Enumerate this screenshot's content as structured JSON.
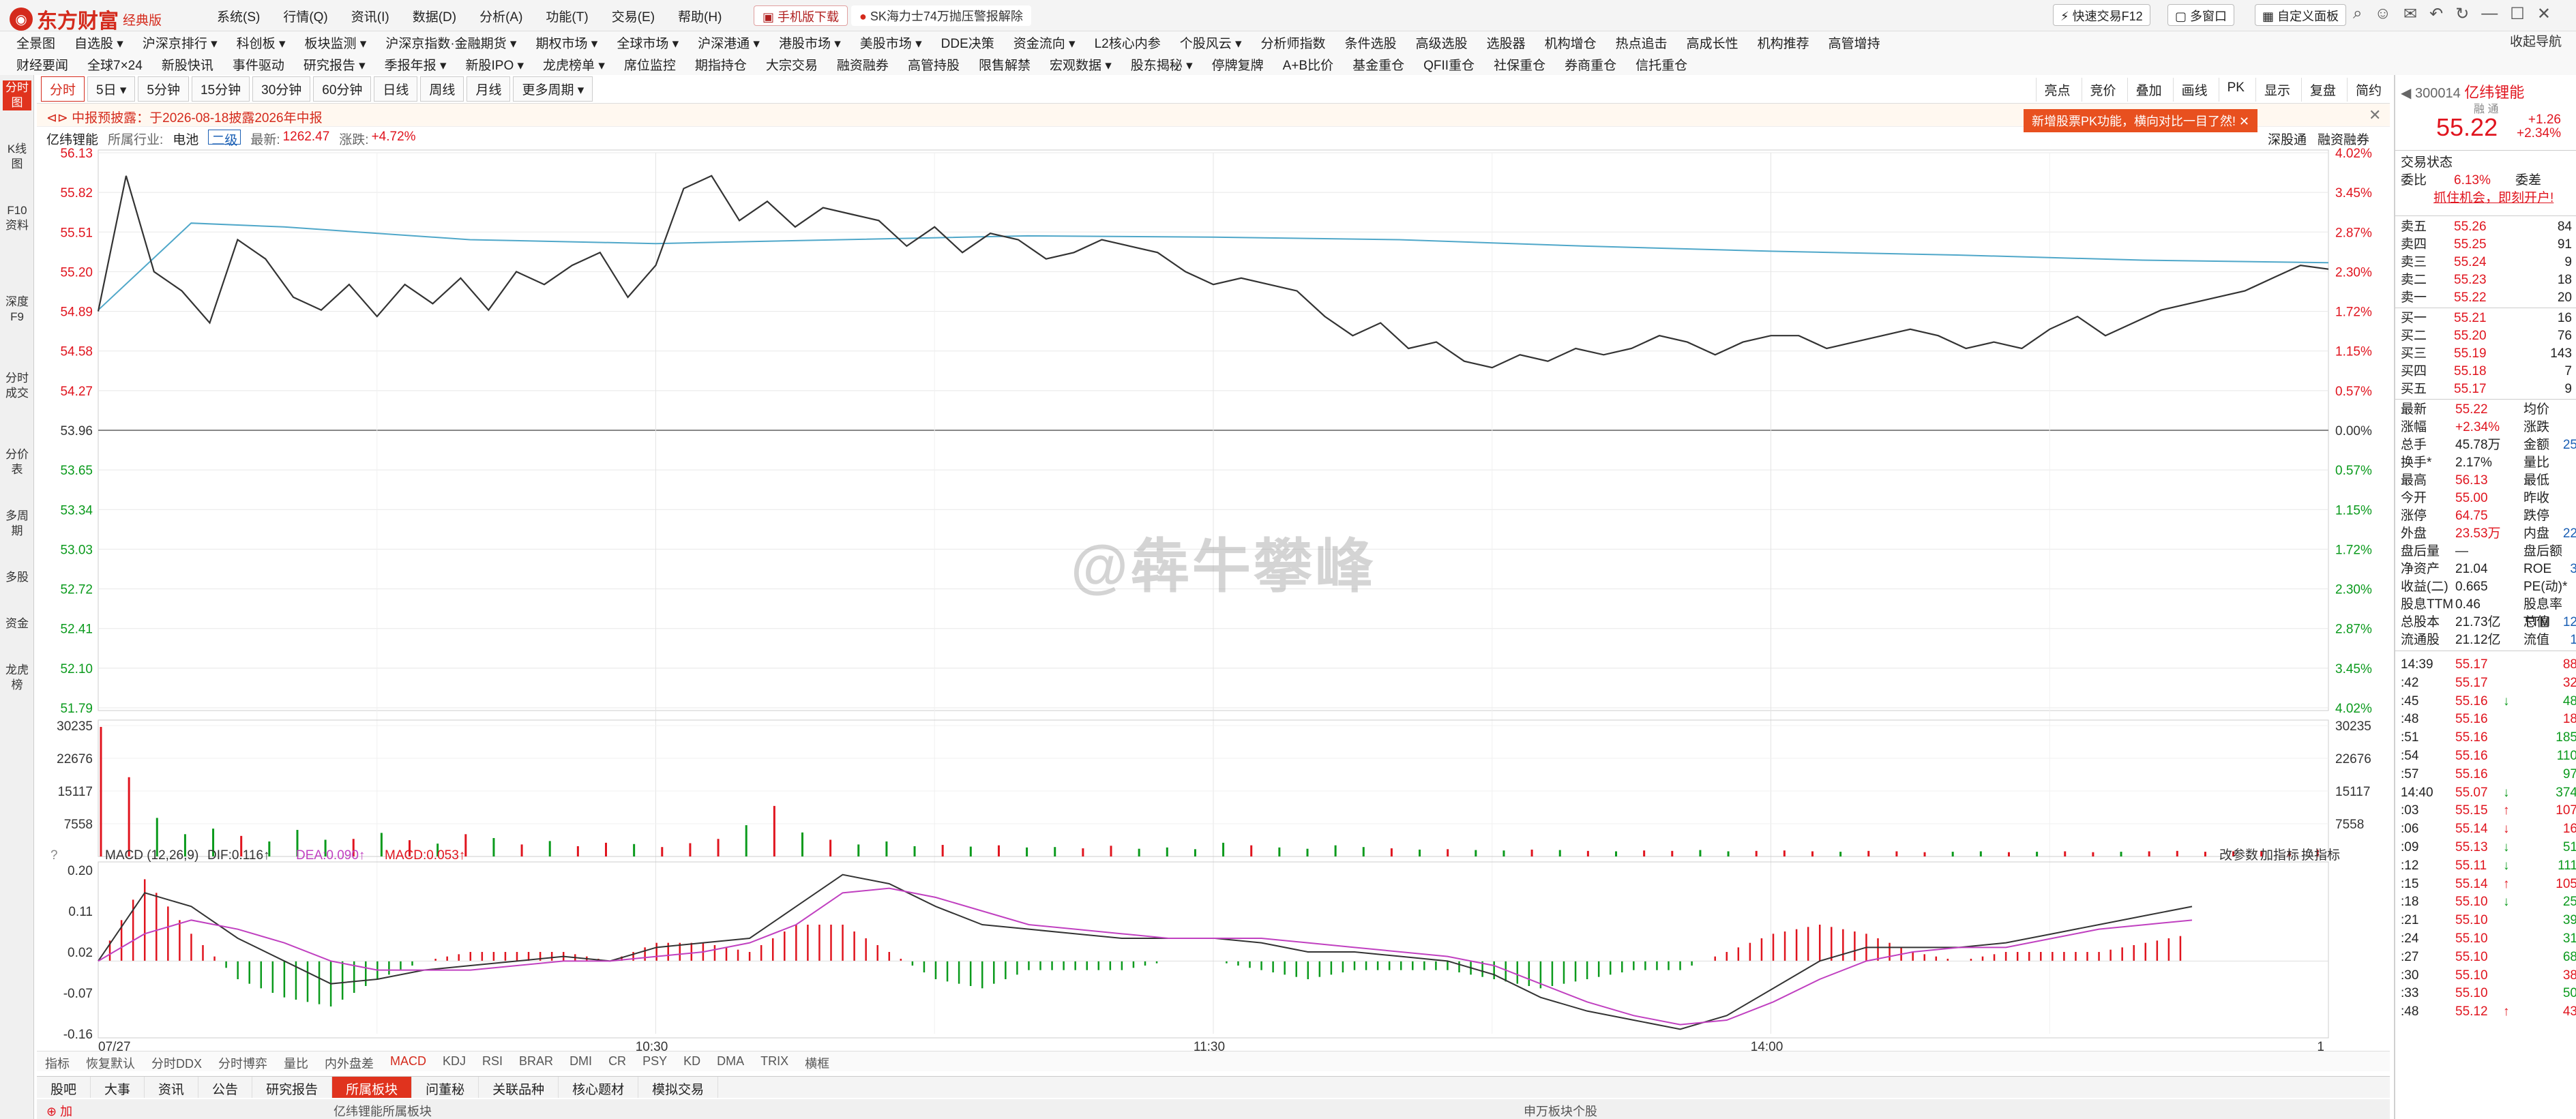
{
  "app": {
    "logo_text": "东方财富",
    "edition": "经典版",
    "menus": [
      "系统(S)",
      "行情(Q)",
      "资讯(I)",
      "数据(D)",
      "分析(A)",
      "功能(T)",
      "交易(E)",
      "帮助(H)"
    ],
    "mobile_download": "手机版下载",
    "promo_news": "SK海力士74万抛压警报解除",
    "quick_trade": "快速交易F12",
    "multi_window": "多窗口",
    "custom_panel": "自定义面板",
    "window_icons": [
      "search-icon",
      "user-icon",
      "mail-icon",
      "back-icon",
      "refresh-icon",
      "minimize-icon",
      "maximize-icon",
      "close-icon"
    ],
    "account_link": "收起导航"
  },
  "nav_row1": [
    "全景图",
    "自选股 ▾",
    "沪深京排行 ▾",
    "科创板 ▾",
    "板块监测 ▾",
    "沪深京指数·金融期货 ▾",
    "期权市场 ▾",
    "全球市场 ▾",
    "沪深港通 ▾",
    "港股市场 ▾",
    "美股市场 ▾",
    "DDE决策",
    "资金流向 ▾",
    "L2核心内参",
    "个股风云 ▾",
    "分析师指数",
    "条件选股",
    "高级选股",
    "选股器",
    "机构增仓",
    "热点追击",
    "高成长性",
    "机构推荐",
    "高管增持"
  ],
  "nav_row2": [
    "财经要闻",
    "全球7×24",
    "新股快讯",
    "事件驱动",
    "研究报告 ▾",
    "季报年报 ▾",
    "新股IPO ▾",
    "龙虎榜单 ▾",
    "席位监控",
    "期指持仓",
    "大宗交易",
    "融资融券",
    "高管持股",
    "限售解禁",
    "宏观数据 ▾",
    "股东揭秘 ▾",
    "停牌复牌",
    "A+B比价",
    "基金重仓",
    "QFII重仓",
    "社保重仓",
    "券商重仓",
    "信托重仓"
  ],
  "left_tabs": [
    "分时图",
    "K线图",
    "F10资料",
    "深度F9",
    "分时成交",
    "分价表",
    "多周期",
    "多股",
    "资金",
    "龙虎榜"
  ],
  "timeframes": [
    "分时",
    "5日 ▾",
    "5分钟",
    "15分钟",
    "30分钟",
    "60分钟",
    "日线",
    "周线",
    "月线",
    "更多周期 ▾"
  ],
  "right_tools": [
    "亮点",
    "竞价",
    "叠加",
    "画线",
    "PK",
    "显示",
    "复盘",
    "简约"
  ],
  "notice": "中报预披露：于2026-08-18披露2026年中报",
  "pk_banner": "新增股票PK功能，横向对比一目了然!",
  "info": {
    "name": "亿纬锂能",
    "industry_label": "所属行业:",
    "industry": "电池",
    "board": "二级",
    "latest_label": "最新:",
    "latest": "1262.47",
    "change_label": "涨跌:",
    "change": "+4.72%",
    "right_links": [
      "深股通",
      "融资融券"
    ]
  },
  "price_axis": {
    "left": [
      "56.13",
      "55.82",
      "55.51",
      "55.20",
      "54.89",
      "54.58",
      "54.27",
      "53.96",
      "53.65",
      "53.34",
      "53.03",
      "52.72",
      "52.41",
      "52.10",
      "51.79"
    ],
    "right": [
      "4.02%",
      "3.45%",
      "2.87%",
      "2.30%",
      "1.72%",
      "1.15%",
      "0.57%",
      "0.00%",
      "0.57%",
      "1.15%",
      "1.72%",
      "2.30%",
      "2.87%",
      "3.45%",
      "4.02%"
    ]
  },
  "volume_axis": [
    "30235",
    "22676",
    "15117",
    "7558"
  ],
  "macd": {
    "title": "MACD (12,26,9)",
    "dif": "DIF:0.116↑",
    "dea": "DEA:0.090↑",
    "macd": "MACD:0.053↑",
    "axis": [
      "0.20",
      "0.11",
      "0.02",
      "-0.07",
      "-0.16"
    ],
    "links": [
      "改参数",
      "加指标",
      "换指标"
    ]
  },
  "time_axis": [
    "07/27",
    "10:30",
    "11:30",
    "14:00",
    "1"
  ],
  "indicator_tabs": [
    "指标",
    "恢复默认",
    "分时DDX",
    "分时博弈",
    "量比",
    "内外盘差",
    "MACD",
    "KDJ",
    "RSI",
    "BRAR",
    "DMI",
    "CR",
    "PSY",
    "KD",
    "DMA",
    "TRIX",
    "横框"
  ],
  "bottom_tabs": [
    "股吧",
    "大事",
    "资讯",
    "公告",
    "研究报告",
    "所属板块",
    "问董秘",
    "关联品种",
    "核心题材",
    "模拟交易"
  ],
  "bottom_hint_left": "亿纬锂能所属板块",
  "bottom_hint_right": "申万板块个股",
  "watermark": "@犇牛攀峰",
  "quote": {
    "code": "300014",
    "name": "亿纬锂能",
    "tags": "融 通",
    "price": "55.22",
    "chg": "+1.26",
    "chg_pct": "+2.34%",
    "status_label": "交易状态",
    "weibi_label": "委比",
    "weibi": "6.13%",
    "weicha_label": "委差",
    "ad": "抓住机会，即刻开户!",
    "asks": [
      {
        "label": "卖五",
        "price": "55.26",
        "vol": "84"
      },
      {
        "label": "卖四",
        "price": "55.25",
        "vol": "91"
      },
      {
        "label": "卖三",
        "price": "55.24",
        "vol": "9"
      },
      {
        "label": "卖二",
        "price": "55.23",
        "vol": "18"
      },
      {
        "label": "卖一",
        "price": "55.22",
        "vol": "20"
      }
    ],
    "bids": [
      {
        "label": "买一",
        "price": "55.21",
        "vol": "16"
      },
      {
        "label": "买二",
        "price": "55.20",
        "vol": "76"
      },
      {
        "label": "买三",
        "price": "55.19",
        "vol": "143"
      },
      {
        "label": "买四",
        "price": "55.18",
        "vol": "7"
      },
      {
        "label": "买五",
        "price": "55.17",
        "vol": "9"
      }
    ],
    "stats": [
      {
        "label": "最新",
        "value": "55.22",
        "label2": "均价"
      },
      {
        "label": "涨幅",
        "value": "+2.34%",
        "label2": "涨跌"
      },
      {
        "label": "总手",
        "value": "45.78万",
        "label2": "金额",
        "value2": "25"
      },
      {
        "label": "换手*",
        "value": "2.17%",
        "label2": "量比"
      },
      {
        "label": "最高",
        "value": "56.13",
        "label2": "最低"
      },
      {
        "label": "今开",
        "value": "55.00",
        "label2": "昨收"
      },
      {
        "label": "涨停",
        "value": "64.75",
        "label2": "跌停"
      },
      {
        "label": "外盘",
        "value": "23.53万",
        "label2": "内盘",
        "value2": "22"
      },
      {
        "label": "盘后量",
        "value": "—",
        "label2": "盘后额"
      },
      {
        "label": "净资产",
        "value": "21.04",
        "label2": "ROE",
        "value2": "3"
      },
      {
        "label": "收益(二)",
        "value": "0.665",
        "label2": "PE(动)*"
      },
      {
        "label": "股息TTM",
        "value": "0.46",
        "label2": "股息率TTM"
      },
      {
        "label": "总股本",
        "value": "21.73亿",
        "label2": "总值",
        "value2": "12"
      },
      {
        "label": "流通股",
        "value": "21.12亿",
        "label2": "流值",
        "value2": "1"
      }
    ],
    "ticks": [
      {
        "t": "14:39",
        "p": "55.17",
        "v": "88",
        "c": "red",
        "arrow": ""
      },
      {
        "t": ":42",
        "p": "55.17",
        "v": "32",
        "c": "red",
        "arrow": ""
      },
      {
        "t": ":45",
        "p": "55.16",
        "v": "48",
        "c": "green",
        "arrow": "↓"
      },
      {
        "t": ":48",
        "p": "55.16",
        "v": "18",
        "c": "red",
        "arrow": ""
      },
      {
        "t": ":51",
        "p": "55.16",
        "v": "185",
        "c": "green",
        "arrow": ""
      },
      {
        "t": ":54",
        "p": "55.16",
        "v": "110",
        "c": "green",
        "arrow": ""
      },
      {
        "t": ":57",
        "p": "55.16",
        "v": "97",
        "c": "green",
        "arrow": ""
      },
      {
        "t": "14:40",
        "p": "55.07",
        "v": "374",
        "c": "green",
        "arrow": "↓"
      },
      {
        "t": ":03",
        "p": "55.15",
        "v": "107",
        "c": "red",
        "arrow": "↑"
      },
      {
        "t": ":06",
        "p": "55.14",
        "v": "16",
        "c": "red",
        "arrow": "↓"
      },
      {
        "t": ":09",
        "p": "55.13",
        "v": "51",
        "c": "green",
        "arrow": "↓"
      },
      {
        "t": ":12",
        "p": "55.11",
        "v": "111",
        "c": "green",
        "arrow": "↓"
      },
      {
        "t": ":15",
        "p": "55.14",
        "v": "105",
        "c": "red",
        "arrow": "↑"
      },
      {
        "t": ":18",
        "p": "55.10",
        "v": "25",
        "c": "green",
        "arrow": "↓"
      },
      {
        "t": ":21",
        "p": "55.10",
        "v": "39",
        "c": "green",
        "arrow": ""
      },
      {
        "t": ":24",
        "p": "55.10",
        "v": "31",
        "c": "green",
        "arrow": ""
      },
      {
        "t": ":27",
        "p": "55.10",
        "v": "68",
        "c": "green",
        "arrow": ""
      },
      {
        "t": ":30",
        "p": "55.10",
        "v": "38",
        "c": "red",
        "arrow": ""
      },
      {
        "t": ":33",
        "p": "55.10",
        "v": "50",
        "c": "green",
        "arrow": ""
      },
      {
        "t": ":48",
        "p": "55.12",
        "v": "43",
        "c": "red",
        "arrow": "↑"
      }
    ]
  },
  "chart_data": {
    "type": "line",
    "title": "亿纬锂能 分时",
    "prev_close": 53.96,
    "ylim": [
      51.79,
      56.13
    ],
    "x_ticks": [
      "07/27",
      "10:30",
      "11:30",
      "14:00"
    ],
    "total_minutes": 240,
    "series": [
      {
        "name": "price",
        "x_minutes": [
          0,
          3,
          6,
          9,
          12,
          15,
          18,
          21,
          24,
          27,
          30,
          33,
          36,
          39,
          42,
          45,
          48,
          51,
          54,
          57,
          60,
          63,
          66,
          69,
          72,
          75,
          78,
          81,
          84,
          87,
          90,
          93,
          96,
          99,
          102,
          105,
          108,
          111,
          114,
          117,
          120,
          123,
          126,
          129,
          132,
          135,
          138,
          141,
          144,
          147,
          150,
          153,
          156,
          159,
          162,
          165,
          168,
          171,
          174,
          177,
          180,
          183,
          186,
          189,
          192,
          195,
          198,
          201,
          204,
          207,
          210,
          213,
          216,
          219,
          222,
          225,
          228,
          231,
          234,
          237,
          240
        ],
        "values": [
          54.89,
          55.95,
          55.2,
          55.05,
          54.8,
          55.45,
          55.3,
          55.0,
          54.9,
          55.1,
          54.85,
          55.1,
          54.95,
          55.15,
          54.9,
          55.2,
          55.1,
          55.25,
          55.35,
          55.0,
          55.25,
          55.85,
          55.95,
          55.6,
          55.75,
          55.55,
          55.7,
          55.65,
          55.6,
          55.4,
          55.55,
          55.35,
          55.5,
          55.45,
          55.3,
          55.35,
          55.45,
          55.4,
          55.35,
          55.2,
          55.1,
          55.15,
          55.1,
          55.05,
          54.85,
          54.7,
          54.8,
          54.6,
          54.65,
          54.5,
          54.45,
          54.55,
          54.5,
          54.6,
          54.55,
          54.6,
          54.7,
          54.65,
          54.55,
          54.65,
          54.7,
          54.7,
          54.6,
          54.65,
          54.7,
          54.75,
          54.7,
          54.6,
          54.65,
          54.6,
          54.75,
          54.85,
          54.7,
          54.8,
          54.9,
          54.95,
          55.0,
          55.05,
          55.15,
          55.25,
          55.22
        ]
      },
      {
        "name": "avg",
        "x_minutes": [
          0,
          10,
          20,
          40,
          60,
          80,
          100,
          120,
          140,
          160,
          180,
          200,
          220,
          240
        ],
        "values": [
          54.9,
          55.58,
          55.55,
          55.45,
          55.42,
          55.45,
          55.48,
          55.47,
          55.45,
          55.4,
          55.36,
          55.33,
          55.29,
          55.27
        ]
      }
    ],
    "volume": {
      "max": 30235,
      "values": [
        30235,
        18500,
        9000,
        5200,
        6500,
        4800,
        3500,
        6200,
        3900,
        4100,
        5500,
        3800,
        3000,
        5200,
        4300,
        2800,
        3600,
        2400,
        3200,
        2900,
        2200,
        3100,
        4100,
        7300,
        11800,
        5600,
        3900,
        2800,
        3500,
        2400,
        2700,
        2300,
        2600,
        2100,
        2200,
        1900,
        2500,
        1800,
        2100,
        1700,
        3200,
        2600,
        2100,
        1800,
        2600,
        2200,
        1900,
        1600,
        1700,
        1500,
        1400,
        1600,
        1500,
        1300,
        1200,
        1400,
        1300,
        1500,
        1200,
        1300,
        1400,
        1200,
        1100,
        1300,
        1200,
        1000,
        1100,
        1200,
        1000,
        1100,
        1200,
        1000,
        1100,
        1200,
        1300,
        1100,
        1200,
        1300,
        1200,
        1600
      ]
    },
    "macd": {
      "ylim": [
        -0.16,
        0.2
      ],
      "dif": [
        0.0,
        0.15,
        0.12,
        0.05,
        0.0,
        -0.05,
        -0.04,
        -0.02,
        -0.01,
        0.0,
        0.01,
        0.0,
        0.03,
        0.04,
        0.05,
        0.12,
        0.19,
        0.17,
        0.12,
        0.08,
        0.07,
        0.06,
        0.05,
        0.05,
        0.05,
        0.04,
        0.02,
        0.02,
        0.01,
        0.0,
        -0.03,
        -0.08,
        -0.11,
        -0.13,
        -0.15,
        -0.12,
        -0.06,
        0.0,
        0.03,
        0.03,
        0.03,
        0.04,
        0.06,
        0.08,
        0.1,
        0.12
      ],
      "dea": [
        0.0,
        0.06,
        0.09,
        0.07,
        0.04,
        0.0,
        -0.02,
        -0.02,
        -0.02,
        -0.01,
        0.0,
        0.0,
        0.01,
        0.02,
        0.04,
        0.08,
        0.15,
        0.16,
        0.14,
        0.11,
        0.08,
        0.07,
        0.06,
        0.05,
        0.05,
        0.05,
        0.04,
        0.03,
        0.02,
        0.01,
        -0.01,
        -0.05,
        -0.09,
        -0.12,
        -0.14,
        -0.13,
        -0.09,
        -0.04,
        0.0,
        0.02,
        0.03,
        0.03,
        0.05,
        0.07,
        0.08,
        0.09
      ],
      "hist_max": 0.06
    }
  }
}
